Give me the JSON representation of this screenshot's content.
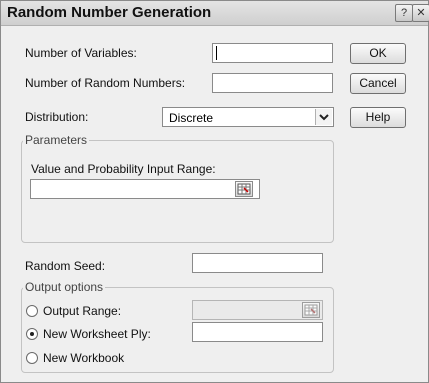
{
  "dialog": {
    "title": "Random Number Generation",
    "help_glyph": "?",
    "close_glyph": "✕"
  },
  "fields": {
    "num_variables": {
      "label": "Number of Variables:",
      "value": ""
    },
    "num_random": {
      "label": "Number of Random Numbers:",
      "value": ""
    },
    "distribution": {
      "label": "Distribution:",
      "value": "Discrete"
    },
    "random_seed": {
      "label": "Random Seed:",
      "value": ""
    }
  },
  "buttons": {
    "ok": "OK",
    "cancel": "Cancel",
    "help": "Help"
  },
  "parameters": {
    "legend": "Parameters",
    "range_label": "Value and Probability Input Range:",
    "range_value": ""
  },
  "output": {
    "legend": "Output options",
    "options": [
      {
        "label": "Output Range:",
        "selected": false
      },
      {
        "label": "New Worksheet Ply:",
        "selected": true
      },
      {
        "label": "New Workbook",
        "selected": false
      }
    ]
  },
  "icons": {
    "dropdown": "chevron-down-icon",
    "range_picker": "range-select-icon"
  }
}
